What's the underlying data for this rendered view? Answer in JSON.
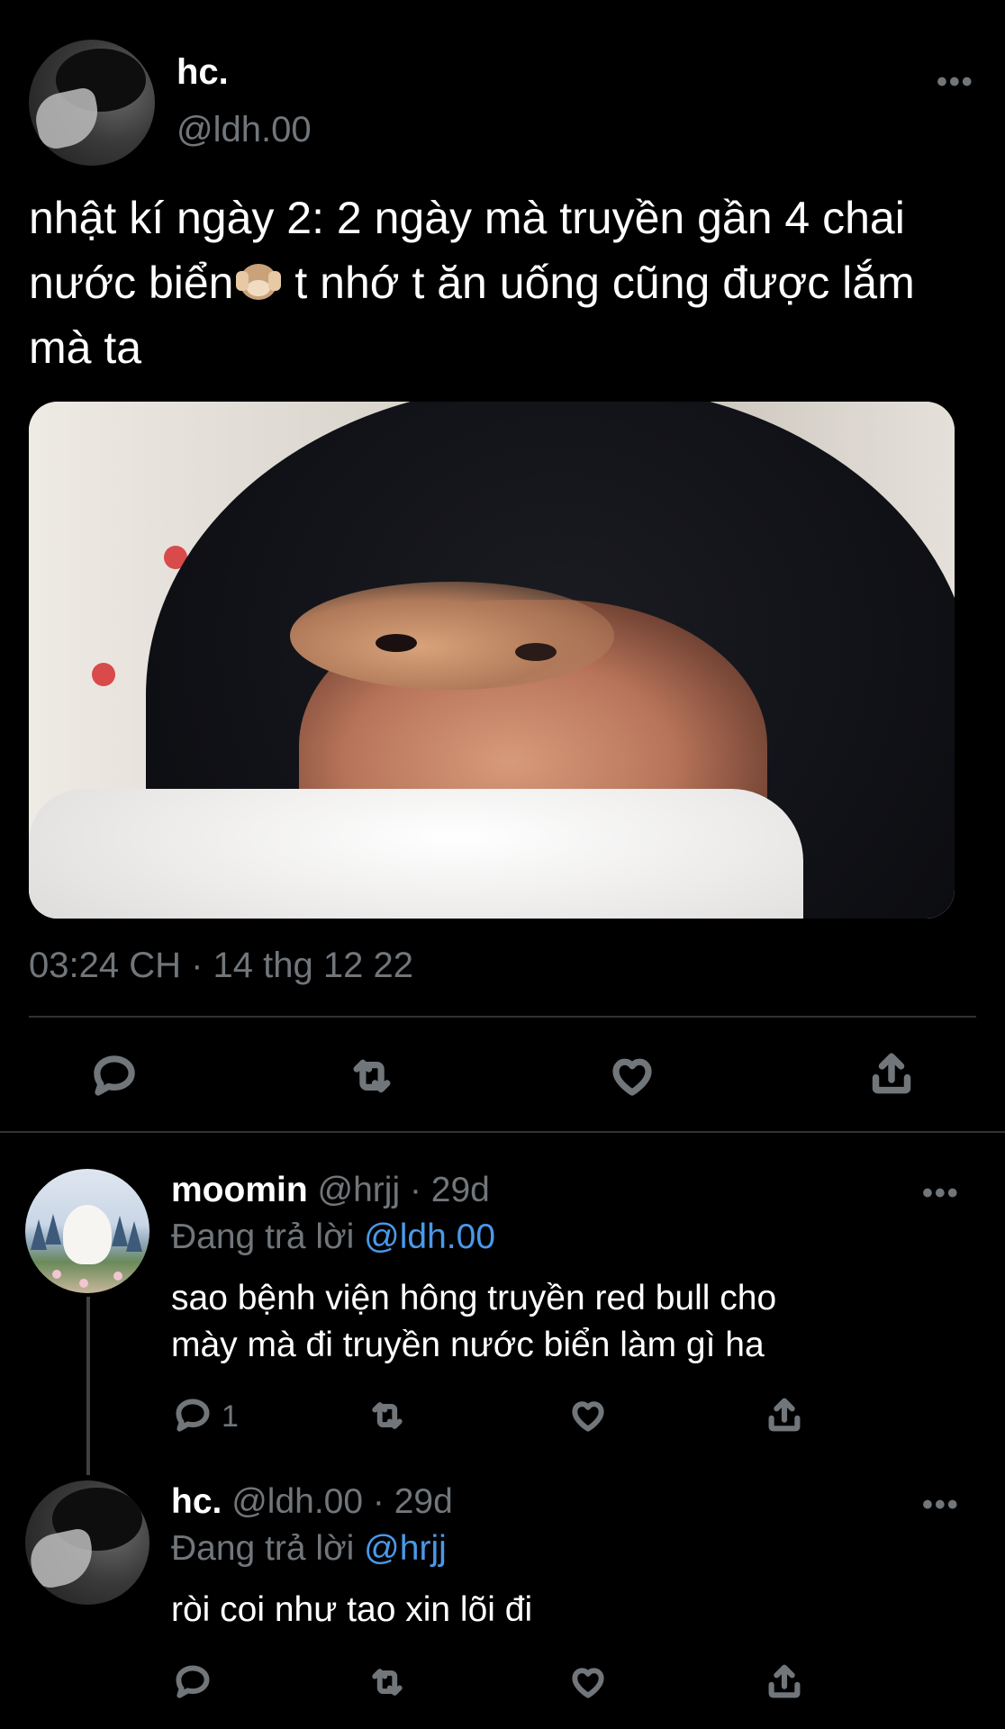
{
  "main_tweet": {
    "author_name": "hc.",
    "author_handle": "@ldh.00",
    "more_label": "•••",
    "text_part1": "nhật kí ngày 2:  2 ngày mà truyền gần 4 chai nước biển",
    "emoji": "see-no-evil-monkey-icon",
    "text_part2": " t nhớ t ăn uống cũng được lắm mà ta",
    "timestamp": "03:24 CH · 14 thg 12 22",
    "actions": [
      "reply-icon",
      "retweet-icon",
      "like-icon",
      "share-icon"
    ]
  },
  "replies": [
    {
      "name": "moomin",
      "handle": "@hrjj",
      "sep": " · ",
      "age": "29d",
      "more_label": "•••",
      "replying_prefix": "Đang trả lời ",
      "replying_to": "@ldh.00",
      "text_line1": "sao bệnh viện hông truyền red bull cho",
      "text_line2": "mày mà đi truyền nước biển làm gì ha",
      "reply_count": "1"
    },
    {
      "name": "hc.",
      "handle": "@ldh.00",
      "sep": " · ",
      "age": "29d",
      "more_label": "•••",
      "replying_prefix": "Đang trả lời ",
      "replying_to": "@hrjj",
      "text_line1": "ròi coi như tao xin lõi đi",
      "reply_count": ""
    }
  ],
  "colors": {
    "background": "#000000",
    "text": "#e7e9ea",
    "secondary": "#71767b",
    "link": "#4a99e9",
    "divider": "#2f3336"
  }
}
